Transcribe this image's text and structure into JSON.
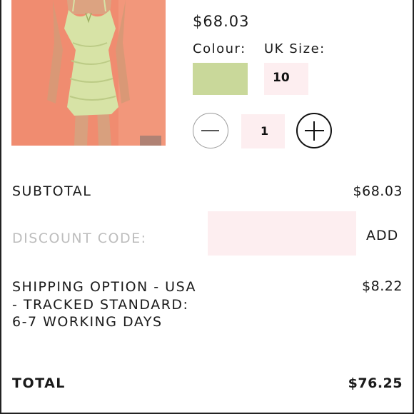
{
  "product": {
    "image_alt": "green ruched corset mini dress",
    "price": "$68.03",
    "colour_label": "Colour:",
    "colour_swatch": "#c9d89a",
    "size_label": "UK Size:",
    "size_value": "10",
    "quantity": "1"
  },
  "summary": {
    "subtotal_label": "SUBTOTAL",
    "subtotal_value": "$68.03",
    "discount_label": "DISCOUNT CODE:",
    "discount_input_value": "",
    "add_label": "ADD",
    "shipping_label": "SHIPPING OPTION - USA - TRACKED STANDARD: 6-7 WORKING DAYS",
    "shipping_value": "$8.22",
    "total_label": "TOTAL",
    "total_value": "$76.25"
  },
  "icons": {
    "minus": "minus-icon",
    "plus": "plus-icon"
  },
  "colors": {
    "input_background": "#fdeef0",
    "muted_text": "#bdbdbd"
  }
}
